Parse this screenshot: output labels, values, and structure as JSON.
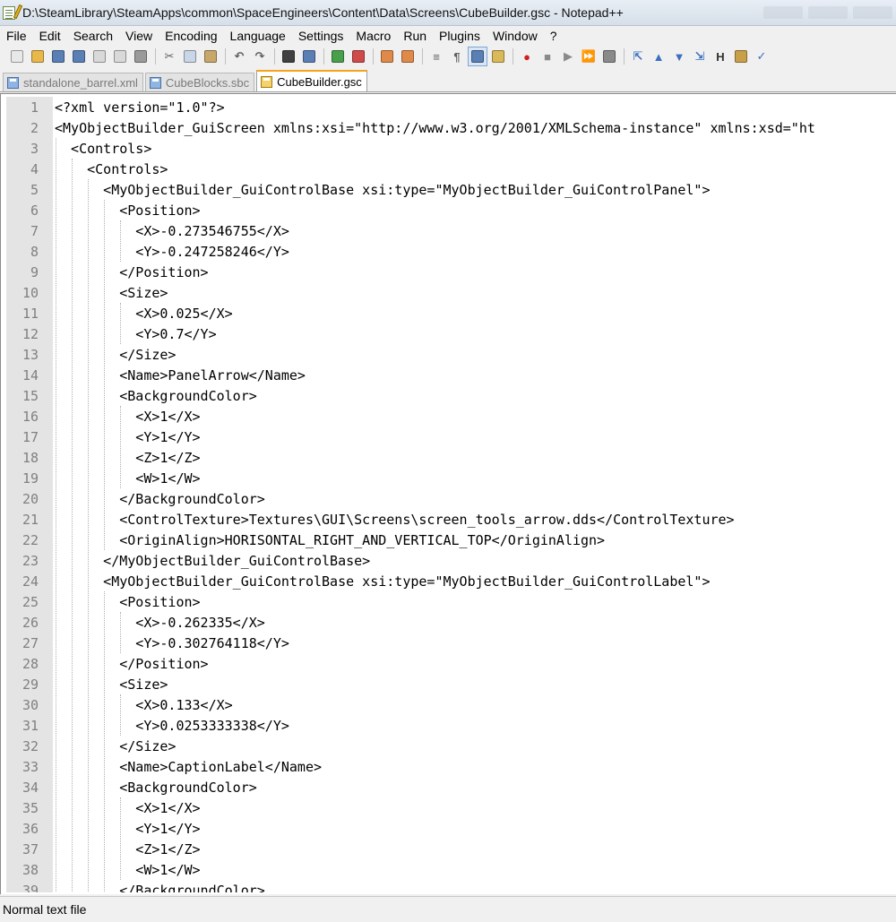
{
  "window": {
    "title": "D:\\SteamLibrary\\SteamApps\\common\\SpaceEngineers\\Content\\Data\\Screens\\CubeBuilder.gsc - Notepad++"
  },
  "menu": [
    "File",
    "Edit",
    "Search",
    "View",
    "Encoding",
    "Language",
    "Settings",
    "Macro",
    "Run",
    "Plugins",
    "Window",
    "?"
  ],
  "toolbar": {
    "buttons": [
      {
        "icon": "new-file-icon",
        "glyph": "",
        "color": "#e8e8e8"
      },
      {
        "icon": "open-file-icon",
        "glyph": "",
        "color": "#e8b84a"
      },
      {
        "icon": "save-icon",
        "glyph": "",
        "color": "#5a7fb5"
      },
      {
        "icon": "save-all-icon",
        "glyph": "",
        "color": "#5a7fb5"
      },
      {
        "icon": "close-icon",
        "glyph": "",
        "color": "#d9d9d9"
      },
      {
        "icon": "close-all-icon",
        "glyph": "",
        "color": "#d9d9d9"
      },
      {
        "icon": "print-icon",
        "glyph": "",
        "color": "#9a9a9a"
      },
      {
        "sep": true
      },
      {
        "icon": "cut-icon",
        "glyph": "✂",
        "color": ""
      },
      {
        "icon": "copy-icon",
        "glyph": "",
        "color": "#c9d6e8"
      },
      {
        "icon": "paste-icon",
        "glyph": "",
        "color": "#c8a86a"
      },
      {
        "sep": true
      },
      {
        "icon": "undo-icon",
        "glyph": "↶",
        "color": ""
      },
      {
        "icon": "redo-icon",
        "glyph": "↷",
        "color": ""
      },
      {
        "sep": true
      },
      {
        "icon": "find-icon",
        "glyph": "",
        "color": "#404040"
      },
      {
        "icon": "replace-icon",
        "glyph": "",
        "color": "#5a7fb5"
      },
      {
        "sep": true
      },
      {
        "icon": "zoom-in-icon",
        "glyph": "",
        "color": "#4aa04a"
      },
      {
        "icon": "zoom-out-icon",
        "glyph": "",
        "color": "#d04a4a"
      },
      {
        "sep": true
      },
      {
        "icon": "sync-vertical-icon",
        "glyph": "",
        "color": "#e08a4a"
      },
      {
        "icon": "sync-horizontal-icon",
        "glyph": "",
        "color": "#e08a4a"
      },
      {
        "sep": true
      },
      {
        "icon": "word-wrap-icon",
        "glyph": "≡",
        "color": ""
      },
      {
        "icon": "show-all-chars-icon",
        "glyph": "¶",
        "color": ""
      },
      {
        "icon": "indent-guide-icon",
        "glyph": "",
        "color": "#5a7fb5",
        "active": true
      },
      {
        "icon": "user-language-icon",
        "glyph": "",
        "color": "#d9b95a"
      },
      {
        "sep": true
      },
      {
        "icon": "record-macro-icon",
        "glyph": "●",
        "color": "",
        "fg": "#d02020"
      },
      {
        "icon": "stop-recording-icon",
        "glyph": "■",
        "color": "",
        "fg": "#8a8a8a"
      },
      {
        "icon": "playback-macro-icon",
        "glyph": "▶",
        "color": "",
        "fg": "#8a8a8a"
      },
      {
        "icon": "run-macro-multiple-icon",
        "glyph": "⏩",
        "color": "",
        "fg": "#3a6fc0"
      },
      {
        "icon": "save-macro-icon",
        "glyph": "",
        "color": "#8a8a8a"
      },
      {
        "sep": true
      },
      {
        "icon": "fold-all-icon",
        "glyph": "⇱",
        "color": "",
        "fg": "#3a6fc0"
      },
      {
        "icon": "arrow-up-icon",
        "glyph": "▲",
        "color": "",
        "fg": "#3a6fc0"
      },
      {
        "icon": "arrow-down-icon",
        "glyph": "▼",
        "color": "",
        "fg": "#3a6fc0"
      },
      {
        "icon": "unfold-all-icon",
        "glyph": "⇲",
        "color": "",
        "fg": "#3a6fc0"
      },
      {
        "icon": "hex-editor-icon",
        "glyph": "H",
        "color": "",
        "fg": "#303030"
      },
      {
        "icon": "plugin-icon",
        "glyph": "",
        "color": "#c9a04a"
      },
      {
        "icon": "spell-check-icon",
        "glyph": "✓",
        "color": "",
        "fg": "#3a6fc0"
      }
    ]
  },
  "tabs": [
    {
      "label": "standalone_barrel.xml",
      "active": false
    },
    {
      "label": "CubeBlocks.sbc",
      "active": false
    },
    {
      "label": "CubeBuilder.gsc",
      "active": true
    }
  ],
  "editor": {
    "lines": [
      {
        "n": "1",
        "text": "<?xml version=\"1.0\"?>"
      },
      {
        "n": "2",
        "text": "<MyObjectBuilder_GuiScreen xmlns:xsi=\"http://www.w3.org/2001/XMLSchema-instance\" xmlns:xsd=\"ht"
      },
      {
        "n": "3",
        "text": "  <Controls>"
      },
      {
        "n": "4",
        "text": "    <Controls>"
      },
      {
        "n": "5",
        "text": "      <MyObjectBuilder_GuiControlBase xsi:type=\"MyObjectBuilder_GuiControlPanel\">"
      },
      {
        "n": "6",
        "text": "        <Position>"
      },
      {
        "n": "7",
        "text": "          <X>-0.273546755</X>"
      },
      {
        "n": "8",
        "text": "          <Y>-0.247258246</Y>"
      },
      {
        "n": "9",
        "text": "        </Position>"
      },
      {
        "n": "10",
        "text": "        <Size>"
      },
      {
        "n": "11",
        "text": "          <X>0.025</X>"
      },
      {
        "n": "12",
        "text": "          <Y>0.7</Y>"
      },
      {
        "n": "13",
        "text": "        </Size>"
      },
      {
        "n": "14",
        "text": "        <Name>PanelArrow</Name>"
      },
      {
        "n": "15",
        "text": "        <BackgroundColor>"
      },
      {
        "n": "16",
        "text": "          <X>1</X>"
      },
      {
        "n": "17",
        "text": "          <Y>1</Y>"
      },
      {
        "n": "18",
        "text": "          <Z>1</Z>"
      },
      {
        "n": "19",
        "text": "          <W>1</W>"
      },
      {
        "n": "20",
        "text": "        </BackgroundColor>"
      },
      {
        "n": "21",
        "text": "        <ControlTexture>Textures\\GUI\\Screens\\screen_tools_arrow.dds</ControlTexture>"
      },
      {
        "n": "22",
        "text": "        <OriginAlign>HORISONTAL_RIGHT_AND_VERTICAL_TOP</OriginAlign>"
      },
      {
        "n": "23",
        "text": "      </MyObjectBuilder_GuiControlBase>"
      },
      {
        "n": "24",
        "text": "      <MyObjectBuilder_GuiControlBase xsi:type=\"MyObjectBuilder_GuiControlLabel\">"
      },
      {
        "n": "25",
        "text": "        <Position>"
      },
      {
        "n": "26",
        "text": "          <X>-0.262335</X>"
      },
      {
        "n": "27",
        "text": "          <Y>-0.302764118</Y>"
      },
      {
        "n": "28",
        "text": "        </Position>"
      },
      {
        "n": "29",
        "text": "        <Size>"
      },
      {
        "n": "30",
        "text": "          <X>0.133</X>"
      },
      {
        "n": "31",
        "text": "          <Y>0.0253333338</Y>"
      },
      {
        "n": "32",
        "text": "        </Size>"
      },
      {
        "n": "33",
        "text": "        <Name>CaptionLabel</Name>"
      },
      {
        "n": "34",
        "text": "        <BackgroundColor>"
      },
      {
        "n": "35",
        "text": "          <X>1</X>"
      },
      {
        "n": "36",
        "text": "          <Y>1</Y>"
      },
      {
        "n": "37",
        "text": "          <Z>1</Z>"
      },
      {
        "n": "38",
        "text": "          <W>1</W>"
      },
      {
        "n": "39",
        "text": "        </BackgroundColor>"
      }
    ]
  },
  "status": {
    "file_type": "Normal text file"
  }
}
